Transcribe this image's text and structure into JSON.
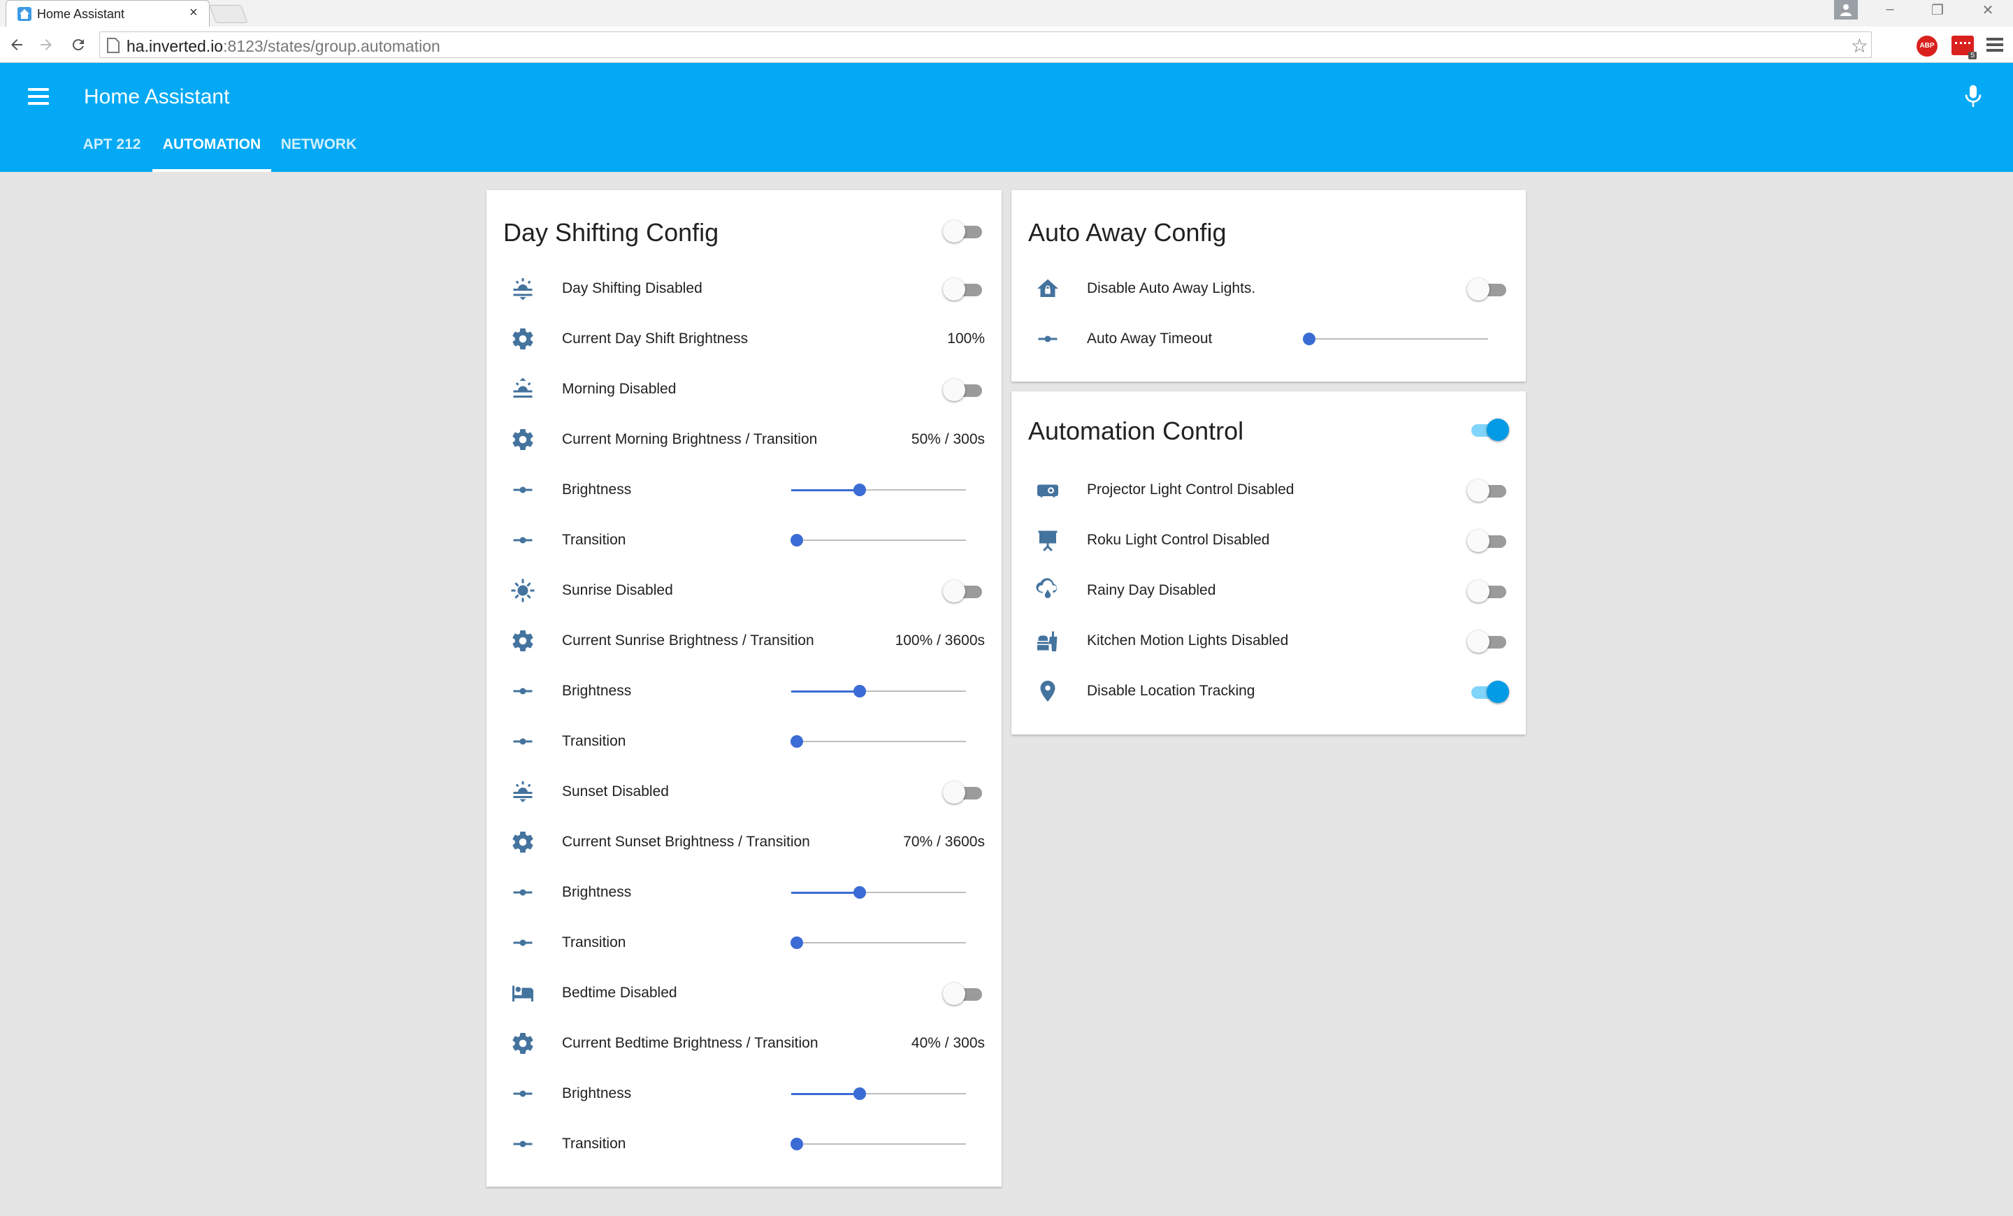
{
  "browser": {
    "tab_title": "Home Assistant",
    "tab_close": "×",
    "url_host": "ha.inverted.io",
    "url_path": ":8123/states/group.automation",
    "ext_abp": "ABP",
    "ext_badge": "5",
    "win_min": "–",
    "win_restore": "❐",
    "win_close": "✕",
    "star": "☆"
  },
  "header": {
    "title": "Home Assistant",
    "tabs": [
      {
        "label": "APT 212",
        "active": false
      },
      {
        "label": "AUTOMATION",
        "active": true
      },
      {
        "label": "NETWORK",
        "active": false
      }
    ]
  },
  "accent_color": "#03a9f4",
  "icon_color": "#44739e",
  "day_shifting": {
    "title": "Day Shifting Config",
    "toggle_on": false,
    "rows": [
      {
        "icon": "weather-sunset-icon",
        "label": "Day Shifting Disabled",
        "type": "toggle",
        "on": false
      },
      {
        "icon": "gear-icon",
        "label": "Current Day Shift Brightness",
        "type": "value",
        "value": "100%"
      },
      {
        "icon": "weather-sunset-up-icon",
        "label": "Morning Disabled",
        "type": "toggle",
        "on": false
      },
      {
        "icon": "gear-icon",
        "label": "Current Morning Brightness / Transition",
        "type": "value",
        "value": "50% / 300s"
      },
      {
        "icon": "slider-icon",
        "label": "Brightness",
        "type": "slider",
        "level": 0.39
      },
      {
        "icon": "slider-icon",
        "label": "Transition",
        "type": "slider",
        "level": 0.03
      },
      {
        "icon": "sun-icon",
        "label": "Sunrise Disabled",
        "type": "toggle",
        "on": false
      },
      {
        "icon": "gear-icon",
        "label": "Current Sunrise Brightness / Transition",
        "type": "value",
        "value": "100% / 3600s"
      },
      {
        "icon": "slider-icon",
        "label": "Brightness",
        "type": "slider",
        "level": 0.39
      },
      {
        "icon": "slider-icon",
        "label": "Transition",
        "type": "slider",
        "level": 0.03
      },
      {
        "icon": "weather-sunset-down-icon",
        "label": "Sunset Disabled",
        "type": "toggle",
        "on": false
      },
      {
        "icon": "gear-icon",
        "label": "Current Sunset Brightness / Transition",
        "type": "value",
        "value": "70% / 3600s"
      },
      {
        "icon": "slider-icon",
        "label": "Brightness",
        "type": "slider",
        "level": 0.39
      },
      {
        "icon": "slider-icon",
        "label": "Transition",
        "type": "slider",
        "level": 0.03
      },
      {
        "icon": "bed-icon",
        "label": "Bedtime Disabled",
        "type": "toggle",
        "on": false
      },
      {
        "icon": "gear-icon",
        "label": "Current Bedtime Brightness / Transition",
        "type": "value",
        "value": "40% / 300s"
      },
      {
        "icon": "slider-icon",
        "label": "Brightness",
        "type": "slider",
        "level": 0.39
      },
      {
        "icon": "slider-icon",
        "label": "Transition",
        "type": "slider",
        "level": 0.03
      }
    ]
  },
  "auto_away": {
    "title": "Auto Away Config",
    "rows": [
      {
        "icon": "home-lock-icon",
        "label": "Disable Auto Away Lights.",
        "type": "toggle",
        "on": false
      },
      {
        "icon": "slider-icon",
        "label": "Auto Away Timeout",
        "type": "slider",
        "level": 0.0
      }
    ]
  },
  "automation_control": {
    "title": "Automation Control",
    "toggle_on": true,
    "rows": [
      {
        "icon": "projector-icon",
        "label": "Projector Light Control Disabled",
        "type": "toggle",
        "on": false
      },
      {
        "icon": "projector-screen-icon",
        "label": "Roku Light Control Disabled",
        "type": "toggle",
        "on": false
      },
      {
        "icon": "weather-rainy-icon",
        "label": "Rainy Day Disabled",
        "type": "toggle",
        "on": false
      },
      {
        "icon": "food-icon",
        "label": "Kitchen Motion Lights Disabled",
        "type": "toggle",
        "on": false
      },
      {
        "icon": "map-marker-icon",
        "label": "Disable Location Tracking",
        "type": "toggle",
        "on": true
      }
    ]
  }
}
